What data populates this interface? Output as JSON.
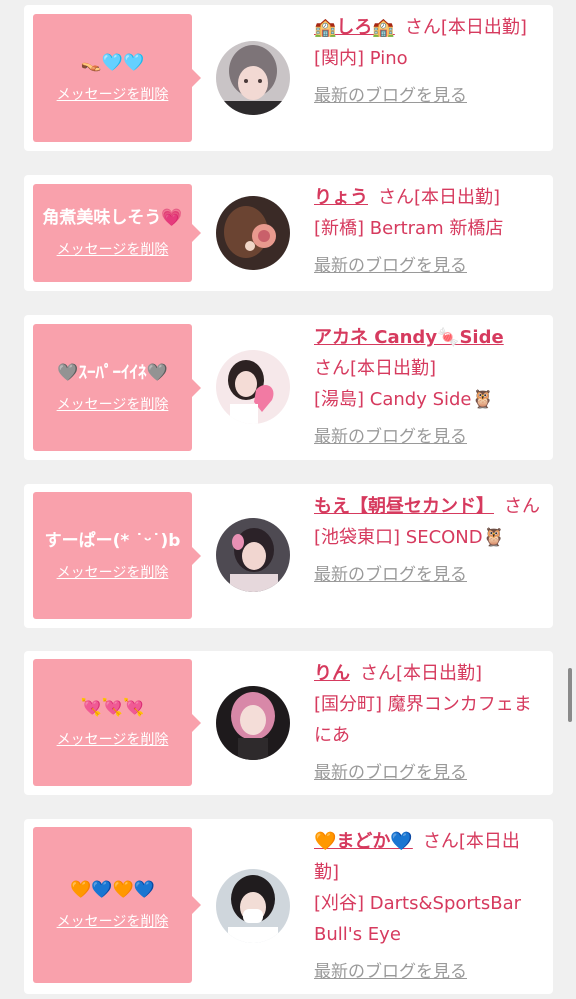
{
  "delete_label": "メッセージを削除",
  "blog_label": "最新のブログを見る",
  "colors": {
    "bubble": "#f9a1ac",
    "name": "#d63a5e",
    "link": "#9a9a9a",
    "page_bg": "#f0f0f0"
  },
  "cards": [
    {
      "message": "👡🩵🩵",
      "name": "🏫しろ🏫",
      "suffix": "さん[本日出勤]",
      "shop": "[関内] Pino",
      "avatar_icon": "profile-photo-icon"
    },
    {
      "message": "角煮美味しそう💗",
      "name": "りょう",
      "suffix": "さん[本日出勤]",
      "shop": "[新橋] Bertram 新橋店",
      "avatar_icon": "profile-photo-icon"
    },
    {
      "message": "🩶ｽｰﾊﾟｰｲｲﾈ🩶",
      "name": "アカネ Candy🍬Side",
      "suffix": "さん[本日出勤]",
      "shop": "[湯島] Candy Side🦉",
      "avatar_icon": "profile-photo-icon"
    },
    {
      "message": "すーぱー(* ˙ᵕ˙)b",
      "name": "もえ【朝昼セカンド】",
      "suffix": "さん",
      "shop": "[池袋東口] SECOND🦉",
      "avatar_icon": "profile-photo-icon"
    },
    {
      "message": "💘💘💘",
      "name": "りん",
      "suffix": "さん[本日出勤]",
      "shop": "[国分町] 魔界コンカフェまにあ",
      "avatar_icon": "profile-photo-icon"
    },
    {
      "message": "🧡💙🧡💙",
      "name": "🧡まどか💙",
      "suffix": "さん[本日出勤]",
      "shop": "[刈谷] Darts&SportsBar Bull's Eye",
      "avatar_icon": "profile-photo-icon"
    }
  ]
}
